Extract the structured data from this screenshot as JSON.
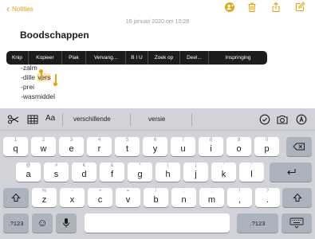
{
  "nav": {
    "back_label": "Notities",
    "icons": [
      "add-person-icon",
      "trash-icon",
      "share-icon",
      "compose-icon"
    ]
  },
  "note": {
    "date": "16 januari 2020 om 10:28",
    "title": "Boodschappen",
    "lines": [
      "-zalm",
      "-dille",
      "-prei",
      "-wasmiddel"
    ],
    "selected_word": "vers"
  },
  "edit_menu": {
    "items": [
      "Knip",
      "Kopieer",
      "Plak",
      "Vervang...",
      "B I U",
      "Zoek op",
      "Deel...",
      "Inspringing"
    ]
  },
  "shortcut_bar": {
    "suggestions": [
      "verschillende",
      "versie"
    ],
    "icons": [
      "scissors-icon",
      "table-icon",
      "text-format-icon",
      "checklist-icon",
      "camera-icon",
      "markup-icon"
    ],
    "format_label": "Aa"
  },
  "keyboard": {
    "row1": [
      {
        "letter": "q",
        "alt": "1"
      },
      {
        "letter": "w",
        "alt": "2"
      },
      {
        "letter": "e",
        "alt": "3"
      },
      {
        "letter": "r",
        "alt": "4"
      },
      {
        "letter": "t",
        "alt": "5"
      },
      {
        "letter": "y",
        "alt": "6"
      },
      {
        "letter": "u",
        "alt": "7"
      },
      {
        "letter": "i",
        "alt": "8"
      },
      {
        "letter": "o",
        "alt": "9"
      },
      {
        "letter": "p",
        "alt": "0"
      }
    ],
    "row2": [
      {
        "letter": "a",
        "alt": "@"
      },
      {
        "letter": "s",
        "alt": "#"
      },
      {
        "letter": "d",
        "alt": "€"
      },
      {
        "letter": "f",
        "alt": "&"
      },
      {
        "letter": "g",
        "alt": "*"
      },
      {
        "letter": "h",
        "alt": "("
      },
      {
        "letter": "j",
        "alt": ")"
      },
      {
        "letter": "k",
        "alt": "'"
      },
      {
        "letter": "l",
        "alt": "\""
      }
    ],
    "row3": [
      {
        "letter": "z",
        "alt": "%"
      },
      {
        "letter": "x",
        "alt": "-"
      },
      {
        "letter": "c",
        "alt": "+"
      },
      {
        "letter": "v",
        "alt": "="
      },
      {
        "letter": "b",
        "alt": "/"
      },
      {
        "letter": "n",
        "alt": ";"
      },
      {
        "letter": "m",
        "alt": ":"
      },
      {
        "letter": ",",
        "alt": "!"
      },
      {
        "letter": ".",
        "alt": "?"
      }
    ],
    "numbers_label": ".?123",
    "emoji_glyph": "☺"
  }
}
